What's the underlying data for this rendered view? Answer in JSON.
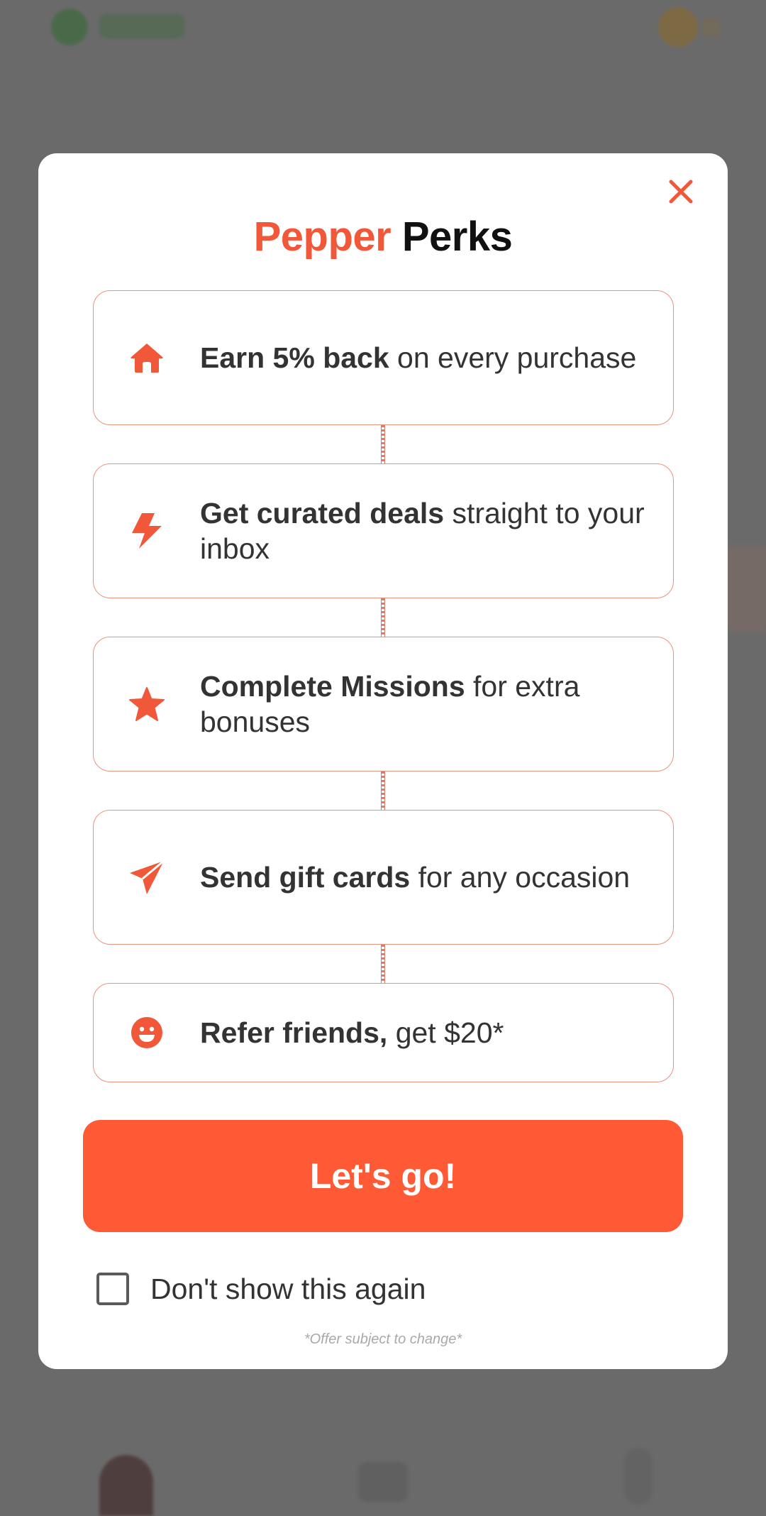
{
  "modal": {
    "title_accent": "Pepper",
    "title_rest": " Perks",
    "close_icon": "close-icon",
    "accent_color": "#f1583a",
    "perks": [
      {
        "icon": "home-icon",
        "bold": "Earn 5% back",
        "rest": " on every purchase"
      },
      {
        "icon": "lightning-icon",
        "bold": "Get curated deals",
        "rest": " straight to your inbox"
      },
      {
        "icon": "star-icon",
        "bold": "Complete Missions",
        "rest": " for extra bonuses"
      },
      {
        "icon": "paper-plane-icon",
        "bold": "Send gift cards",
        "rest": " for any occasion"
      },
      {
        "icon": "smiley-icon",
        "bold": "Refer friends,",
        "rest": " get $20*"
      }
    ],
    "cta_label": "Let's go!",
    "cta_color": "#ff5a36",
    "dont_show_label": "Don't show this again",
    "dont_show_checked": false,
    "disclaimer": "*Offer subject to change*"
  }
}
